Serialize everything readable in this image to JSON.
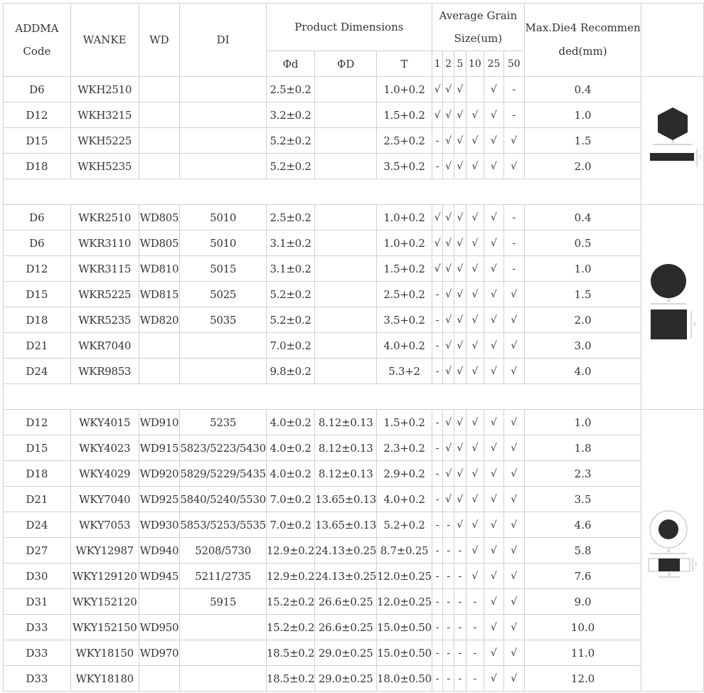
{
  "headers": {
    "addma": "ADDMA Code",
    "wanke": "WANKE",
    "wd": "WD",
    "di": "DI",
    "product_dimensions": "Product Dimensions",
    "phi_d": "Φd",
    "phi_D": "ΦD",
    "t": "T",
    "grain_size": "Average Grain Size(um)",
    "grain_cols": [
      "1",
      "2",
      "5",
      "10",
      "25",
      "50"
    ],
    "max_die": "Max.Die4 Recommended(mm)"
  },
  "groups": [
    {
      "shape": "hexagon",
      "rows": [
        {
          "addma": "D6",
          "wanke": "WKH2510",
          "wd": "",
          "di": "",
          "phi_d": "2.5±0.2",
          "phi_D": "",
          "t": "1.0+0.2",
          "grains": [
            "√",
            "√",
            "√",
            "",
            "√",
            "-"
          ],
          "max_die": "0.4"
        },
        {
          "addma": "D12",
          "wanke": "WKH3215",
          "wd": "",
          "di": "",
          "phi_d": "3.2±0.2",
          "phi_D": "",
          "t": "1.5+0.2",
          "grains": [
            "√",
            "√",
            "√",
            "√",
            "√",
            "-"
          ],
          "max_die": "1.0"
        },
        {
          "addma": "D15",
          "wanke": "WKH5225",
          "wd": "",
          "di": "",
          "phi_d": "5.2±0.2",
          "phi_D": "",
          "t": "2.5+0.2",
          "grains": [
            "-",
            "√",
            "√",
            "√",
            "√",
            "√"
          ],
          "max_die": "1.5"
        },
        {
          "addma": "D18",
          "wanke": "WKH5235",
          "wd": "",
          "di": "",
          "phi_d": "5.2±0.2",
          "phi_D": "",
          "t": "3.5+0.2",
          "grains": [
            "-",
            "√",
            "√",
            "√",
            "√",
            "√"
          ],
          "max_die": "2.0"
        }
      ]
    },
    {
      "shape": "round",
      "rows": [
        {
          "addma": "D6",
          "wanke": "WKR2510",
          "wd": "WD805",
          "di": "5010",
          "phi_d": "2.5±0.2",
          "phi_D": "",
          "t": "1.0+0.2",
          "grains": [
            "√",
            "√",
            "√",
            "√",
            "√",
            "-"
          ],
          "max_die": "0.4"
        },
        {
          "addma": "D6",
          "wanke": "WKR3110",
          "wd": "WD805",
          "di": "5010",
          "phi_d": "3.1±0.2",
          "phi_D": "",
          "t": "1.0+0.2",
          "grains": [
            "√",
            "√",
            "√",
            "√",
            "√",
            "-"
          ],
          "max_die": "0.5"
        },
        {
          "addma": "D12",
          "wanke": "WKR3115",
          "wd": "WD810",
          "di": "5015",
          "phi_d": "3.1±0.2",
          "phi_D": "",
          "t": "1.5+0.2",
          "grains": [
            "√",
            "√",
            "√",
            "√",
            "√",
            "-"
          ],
          "max_die": "1.0"
        },
        {
          "addma": "D15",
          "wanke": "WKR5225",
          "wd": "WD815",
          "di": "5025",
          "phi_d": "5.2±0.2",
          "phi_D": "",
          "t": "2.5+0.2",
          "grains": [
            "-",
            "√",
            "√",
            "√",
            "√",
            "√"
          ],
          "max_die": "1.5"
        },
        {
          "addma": "D18",
          "wanke": "WKR5235",
          "wd": "WD820",
          "di": "5035",
          "phi_d": "5.2±0.2",
          "phi_D": "",
          "t": "3.5+0.2",
          "grains": [
            "-",
            "√",
            "√",
            "√",
            "√",
            "√"
          ],
          "max_die": "2.0"
        },
        {
          "addma": "D21",
          "wanke": "WKR7040",
          "wd": "",
          "di": "",
          "phi_d": "7.0±0.2",
          "phi_D": "",
          "t": "4.0+0.2",
          "grains": [
            "-",
            "√",
            "√",
            "√",
            "√",
            "√"
          ],
          "max_die": "3.0"
        },
        {
          "addma": "D24",
          "wanke": "WKR9853",
          "wd": "",
          "di": "",
          "phi_d": "9.8±0.2",
          "phi_D": "",
          "t": "5.3+2",
          "grains": [
            "-",
            "√",
            "√",
            "√",
            "√",
            "√"
          ],
          "max_die": "4.0"
        }
      ]
    },
    {
      "shape": "ring",
      "rows": [
        {
          "addma": "D12",
          "wanke": "WKY4015",
          "wd": "WD910",
          "di": "5235",
          "phi_d": "4.0±0.2",
          "phi_D": "8.12±0.13",
          "t": "1.5+0.2",
          "grains": [
            "-",
            "√",
            "√",
            "√",
            "√",
            "√"
          ],
          "max_die": "1.0"
        },
        {
          "addma": "D15",
          "wanke": "WKY4023",
          "wd": "WD915",
          "di": "5823/5223/5430",
          "phi_d": "4.0±0.2",
          "phi_D": "8.12±0.13",
          "t": "2.3+0.2",
          "grains": [
            "-",
            "√",
            "√",
            "√",
            "√",
            "√"
          ],
          "max_die": "1.8"
        },
        {
          "addma": "D18",
          "wanke": "WKY4029",
          "wd": "WD920",
          "di": "5829/5229/5435",
          "phi_d": "4.0±0.2",
          "phi_D": "8.12±0.13",
          "t": "2.9+0.2",
          "grains": [
            "-",
            "√",
            "√",
            "√",
            "√",
            "√"
          ],
          "max_die": "2.3"
        },
        {
          "addma": "D21",
          "wanke": "WKY7040",
          "wd": "WD925",
          "di": "5840/5240/5530",
          "phi_d": "7.0±0.2",
          "phi_D": "13.65±0.13",
          "t": "4.0+0.2",
          "grains": [
            "-",
            "√",
            "√",
            "√",
            "√",
            "√"
          ],
          "max_die": "3.5"
        },
        {
          "addma": "D24",
          "wanke": "WKY7053",
          "wd": "WD930",
          "di": "5853/5253/5535",
          "phi_d": "7.0±0.2",
          "phi_D": "13.65±0.13",
          "t": "5.2+0.2",
          "grains": [
            "-",
            "-",
            "√",
            "√",
            "√",
            "√"
          ],
          "max_die": "4.6"
        },
        {
          "addma": "D27",
          "wanke": "WKY12987",
          "wd": "WD940",
          "di": "5208/5730",
          "phi_d": "12.9±0.2",
          "phi_D": "24.13±0.25",
          "t": "8.7±0.25",
          "grains": [
            "-",
            "-",
            "-",
            "√",
            "√",
            "√"
          ],
          "max_die": "5.8"
        },
        {
          "addma": "D30",
          "wanke": "WKY129120",
          "wd": "WD945",
          "di": "5211/2735",
          "phi_d": "12.9±0.2",
          "phi_D": "24.13±0.25",
          "t": "12.0±0.25",
          "grains": [
            "-",
            "-",
            "-",
            "√",
            "√",
            "√"
          ],
          "max_die": "7.6"
        },
        {
          "addma": "D31",
          "wanke": "WKY152120",
          "wd": "",
          "di": "5915",
          "phi_d": "15.2±0.2",
          "phi_D": "26.6±0.25",
          "t": "12.0±0.25",
          "grains": [
            "-",
            "-",
            "-",
            "-",
            "√",
            "√"
          ],
          "max_die": "9.0"
        },
        {
          "addma": "D33",
          "wanke": "WKY152150",
          "wd": "WD950",
          "di": "",
          "phi_d": "15.2±0.2",
          "phi_D": "26.6±0.25",
          "t": "15.0±0.50",
          "grains": [
            "-",
            "-",
            "-",
            "-",
            "√",
            "√"
          ],
          "max_die": "10.0"
        },
        {
          "addma": "D33",
          "wanke": "WKY18150",
          "wd": "WD970",
          "di": "",
          "phi_d": "18.5±0.2",
          "phi_D": "29.0±0.25",
          "t": "15.0±0.50",
          "grains": [
            "-",
            "-",
            "-",
            "-",
            "√",
            "√"
          ],
          "max_die": "11.0"
        },
        {
          "addma": "D33",
          "wanke": "WKY18180",
          "wd": "",
          "di": "",
          "phi_d": "18.5±0.2",
          "phi_D": "29.0±0.25",
          "t": "18.0±0.50",
          "grains": [
            "-",
            "-",
            "-",
            "-",
            "√",
            "√"
          ],
          "max_die": "12.0"
        }
      ]
    }
  ],
  "diagram_labels": {
    "d": "d",
    "t": "T"
  },
  "colors": {
    "border": "#d0d0d0",
    "text": "#333333",
    "shape_fill": "#2b2b2b"
  }
}
